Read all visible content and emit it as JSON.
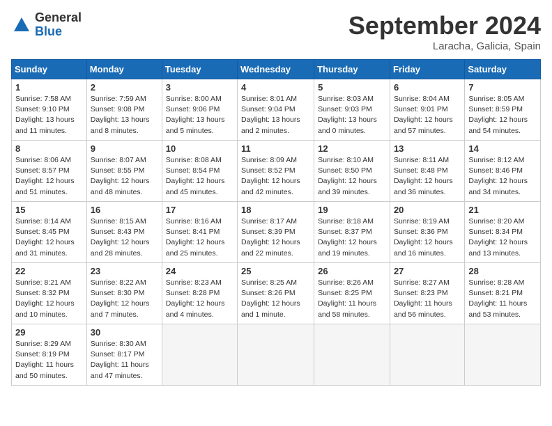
{
  "logo": {
    "general": "General",
    "blue": "Blue"
  },
  "title": "September 2024",
  "location": "Laracha, Galicia, Spain",
  "headers": [
    "Sunday",
    "Monday",
    "Tuesday",
    "Wednesday",
    "Thursday",
    "Friday",
    "Saturday"
  ],
  "weeks": [
    [
      {
        "day": "1",
        "info": "Sunrise: 7:58 AM\nSunset: 9:10 PM\nDaylight: 13 hours\nand 11 minutes."
      },
      {
        "day": "2",
        "info": "Sunrise: 7:59 AM\nSunset: 9:08 PM\nDaylight: 13 hours\nand 8 minutes."
      },
      {
        "day": "3",
        "info": "Sunrise: 8:00 AM\nSunset: 9:06 PM\nDaylight: 13 hours\nand 5 minutes."
      },
      {
        "day": "4",
        "info": "Sunrise: 8:01 AM\nSunset: 9:04 PM\nDaylight: 13 hours\nand 2 minutes."
      },
      {
        "day": "5",
        "info": "Sunrise: 8:03 AM\nSunset: 9:03 PM\nDaylight: 13 hours\nand 0 minutes."
      },
      {
        "day": "6",
        "info": "Sunrise: 8:04 AM\nSunset: 9:01 PM\nDaylight: 12 hours\nand 57 minutes."
      },
      {
        "day": "7",
        "info": "Sunrise: 8:05 AM\nSunset: 8:59 PM\nDaylight: 12 hours\nand 54 minutes."
      }
    ],
    [
      {
        "day": "8",
        "info": "Sunrise: 8:06 AM\nSunset: 8:57 PM\nDaylight: 12 hours\nand 51 minutes."
      },
      {
        "day": "9",
        "info": "Sunrise: 8:07 AM\nSunset: 8:55 PM\nDaylight: 12 hours\nand 48 minutes."
      },
      {
        "day": "10",
        "info": "Sunrise: 8:08 AM\nSunset: 8:54 PM\nDaylight: 12 hours\nand 45 minutes."
      },
      {
        "day": "11",
        "info": "Sunrise: 8:09 AM\nSunset: 8:52 PM\nDaylight: 12 hours\nand 42 minutes."
      },
      {
        "day": "12",
        "info": "Sunrise: 8:10 AM\nSunset: 8:50 PM\nDaylight: 12 hours\nand 39 minutes."
      },
      {
        "day": "13",
        "info": "Sunrise: 8:11 AM\nSunset: 8:48 PM\nDaylight: 12 hours\nand 36 minutes."
      },
      {
        "day": "14",
        "info": "Sunrise: 8:12 AM\nSunset: 8:46 PM\nDaylight: 12 hours\nand 34 minutes."
      }
    ],
    [
      {
        "day": "15",
        "info": "Sunrise: 8:14 AM\nSunset: 8:45 PM\nDaylight: 12 hours\nand 31 minutes."
      },
      {
        "day": "16",
        "info": "Sunrise: 8:15 AM\nSunset: 8:43 PM\nDaylight: 12 hours\nand 28 minutes."
      },
      {
        "day": "17",
        "info": "Sunrise: 8:16 AM\nSunset: 8:41 PM\nDaylight: 12 hours\nand 25 minutes."
      },
      {
        "day": "18",
        "info": "Sunrise: 8:17 AM\nSunset: 8:39 PM\nDaylight: 12 hours\nand 22 minutes."
      },
      {
        "day": "19",
        "info": "Sunrise: 8:18 AM\nSunset: 8:37 PM\nDaylight: 12 hours\nand 19 minutes."
      },
      {
        "day": "20",
        "info": "Sunrise: 8:19 AM\nSunset: 8:36 PM\nDaylight: 12 hours\nand 16 minutes."
      },
      {
        "day": "21",
        "info": "Sunrise: 8:20 AM\nSunset: 8:34 PM\nDaylight: 12 hours\nand 13 minutes."
      }
    ],
    [
      {
        "day": "22",
        "info": "Sunrise: 8:21 AM\nSunset: 8:32 PM\nDaylight: 12 hours\nand 10 minutes."
      },
      {
        "day": "23",
        "info": "Sunrise: 8:22 AM\nSunset: 8:30 PM\nDaylight: 12 hours\nand 7 minutes."
      },
      {
        "day": "24",
        "info": "Sunrise: 8:23 AM\nSunset: 8:28 PM\nDaylight: 12 hours\nand 4 minutes."
      },
      {
        "day": "25",
        "info": "Sunrise: 8:25 AM\nSunset: 8:26 PM\nDaylight: 12 hours\nand 1 minute."
      },
      {
        "day": "26",
        "info": "Sunrise: 8:26 AM\nSunset: 8:25 PM\nDaylight: 11 hours\nand 58 minutes."
      },
      {
        "day": "27",
        "info": "Sunrise: 8:27 AM\nSunset: 8:23 PM\nDaylight: 11 hours\nand 56 minutes."
      },
      {
        "day": "28",
        "info": "Sunrise: 8:28 AM\nSunset: 8:21 PM\nDaylight: 11 hours\nand 53 minutes."
      }
    ],
    [
      {
        "day": "29",
        "info": "Sunrise: 8:29 AM\nSunset: 8:19 PM\nDaylight: 11 hours\nand 50 minutes."
      },
      {
        "day": "30",
        "info": "Sunrise: 8:30 AM\nSunset: 8:17 PM\nDaylight: 11 hours\nand 47 minutes."
      },
      null,
      null,
      null,
      null,
      null
    ]
  ]
}
